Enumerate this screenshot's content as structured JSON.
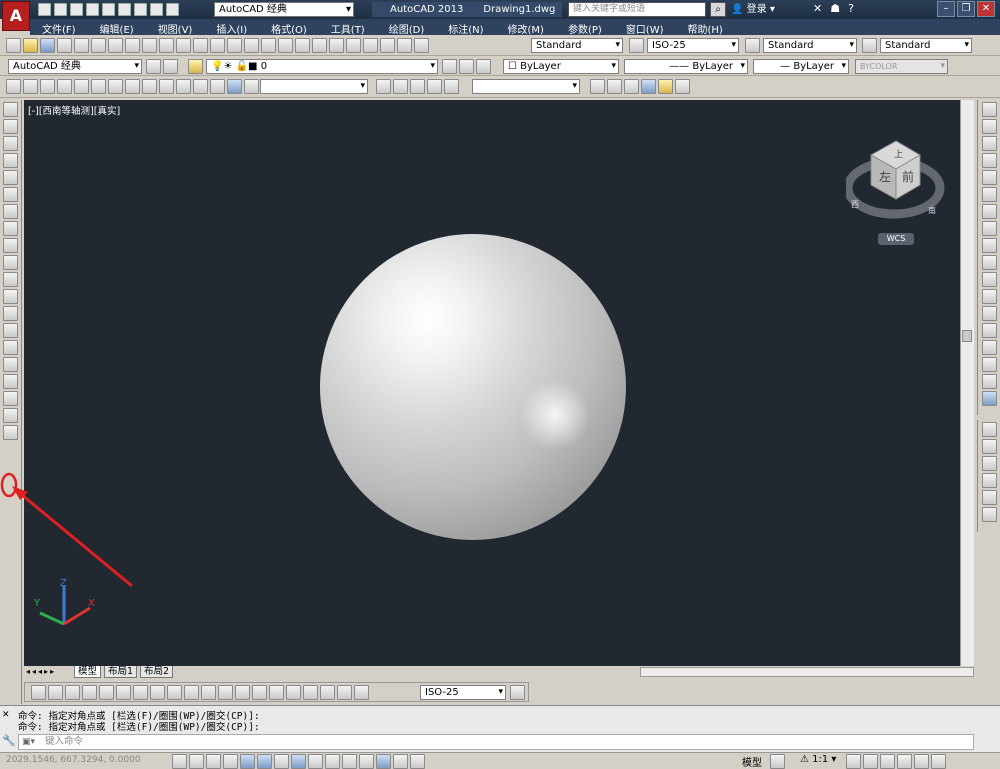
{
  "titlebar": {
    "app_logo": "A",
    "workspace": "AutoCAD 经典",
    "app_name": "AutoCAD 2013",
    "drawing_name": "Drawing1.dwg",
    "search_placeholder": "键入关键字或短语",
    "login": "登录",
    "help": "?"
  },
  "menu": [
    "文件(F)",
    "编辑(E)",
    "视图(V)",
    "插入(I)",
    "格式(O)",
    "工具(T)",
    "绘图(D)",
    "标注(N)",
    "修改(M)",
    "参数(P)",
    "窗口(W)",
    "帮助(H)"
  ],
  "styles_toolbar": {
    "text_style": "Standard",
    "dim_style": "ISO-25",
    "table_style": "Standard",
    "multileader_style": "Standard"
  },
  "layers_toolbar": {
    "workspace_dropdown": "AutoCAD 经典",
    "layer": "0",
    "color": "ByLayer",
    "linetype": "ByLayer",
    "lineweight": "ByLayer",
    "plotstyle": "BYCOLOR"
  },
  "viewport": {
    "label": "[-][西南等轴测][真实]",
    "viewcube_top": "上",
    "viewcube_left": "左",
    "viewcube_front": "前",
    "compass_w": "西",
    "compass_s": "南",
    "wcs": "WCS",
    "background": "#212830"
  },
  "ucs": {
    "x": "X",
    "y": "Y",
    "z": "Z"
  },
  "tabs": {
    "model": "模型",
    "layout1": "布局1",
    "layout2": "布局2"
  },
  "dim_toolbar": {
    "dim_style": "ISO-25"
  },
  "command": {
    "line1": "命令: 指定对角点或 [栏选(F)/圈围(WP)/圈交(CP)]:",
    "line2": "命令: 指定对角点或 [栏选(F)/圈围(WP)/圈交(CP)]:",
    "input_placeholder": "键入命令"
  },
  "status": {
    "coords": "2029.1546, 667.3294, 0.0000",
    "model": "模型",
    "scale": "1:1"
  },
  "annotation_color": "#e02020"
}
